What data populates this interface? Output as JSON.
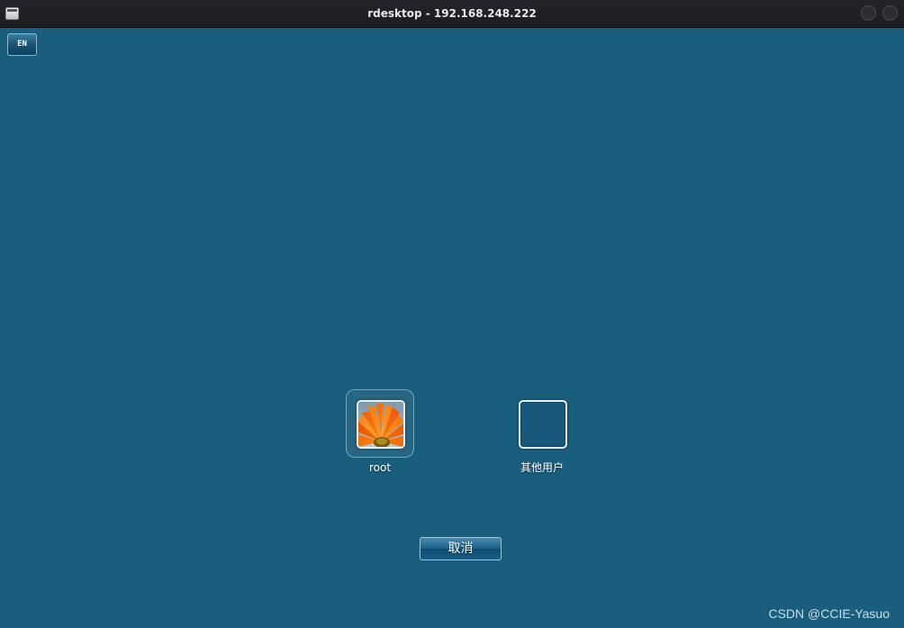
{
  "window": {
    "title": "rdesktop - 192.168.248.222"
  },
  "toolbar": {
    "language_label": "EN"
  },
  "users": [
    {
      "name": "root",
      "avatar": "orange-flower-picture"
    },
    {
      "name": "其他用户",
      "avatar": "empty-frame"
    }
  ],
  "actions": {
    "cancel_label": "取消"
  },
  "watermark": {
    "text": "CSDN @CCIE-Yasuo"
  },
  "colors": {
    "background": "#1a5e7d",
    "titlebar": "#1f2024",
    "button_accent": "#1b5e86"
  }
}
